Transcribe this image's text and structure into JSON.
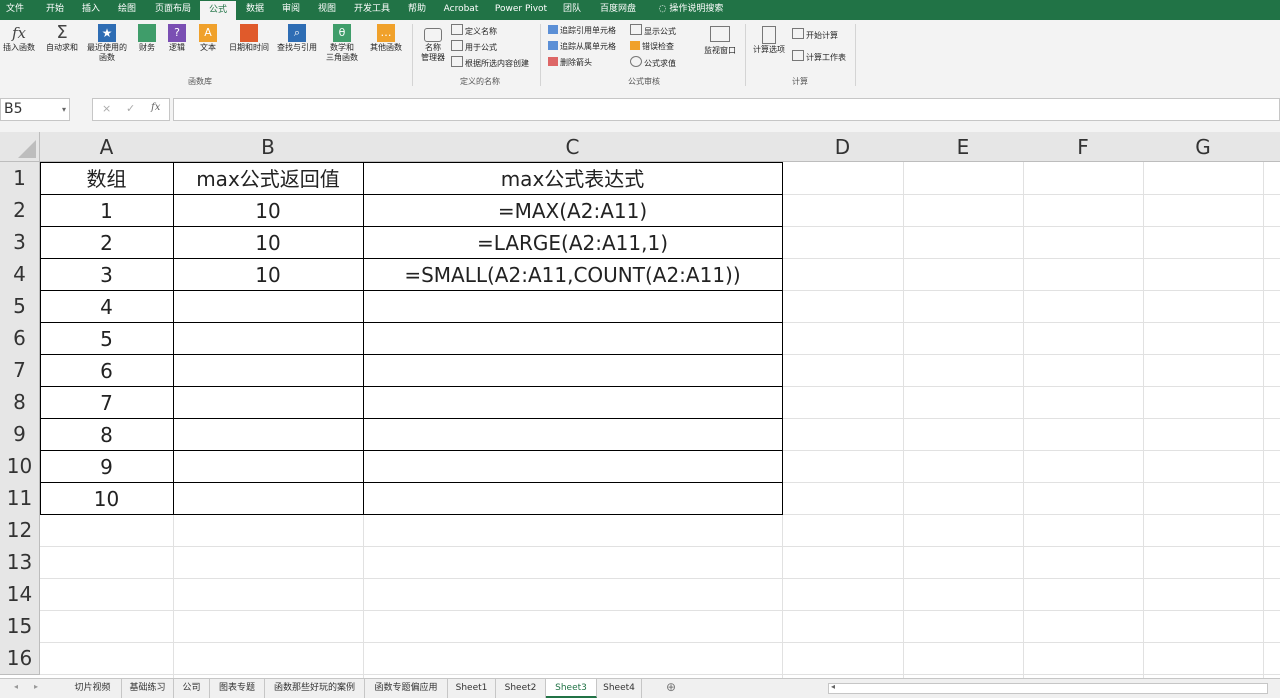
{
  "ribbon_tabs": [
    "文件",
    "开始",
    "插入",
    "绘图",
    "页面布局",
    "公式",
    "数据",
    "审阅",
    "视图",
    "开发工具",
    "帮助",
    "Acrobat",
    "Power Pivot",
    "团队",
    "百度网盘",
    "操作说明搜索"
  ],
  "ribbon": {
    "insert_function": "插入函数",
    "autosum": "自动求和",
    "recent": [
      "最近使用的",
      "函数"
    ],
    "financial": "财务",
    "logical": "逻辑",
    "text": "文本",
    "datetime": "日期和时间",
    "lookup": "查找与引用",
    "math": [
      "数学和",
      "三角函数"
    ],
    "other": "其他函数",
    "group_library": "函数库",
    "name_manager": [
      "名称",
      "管理器"
    ],
    "define_name": "定义名称",
    "use_in_formula": "用于公式",
    "create_from_selection": "根据所选内容创建",
    "group_names": "定义的名称",
    "trace_precedents": "追踪引用单元格",
    "trace_dependents": "追踪从属单元格",
    "remove_arrows": "删除箭头",
    "show_formulas": "显示公式",
    "error_checking": "错误检查",
    "evaluate_formula": "公式求值",
    "watch_window": "监视窗口",
    "group_audit": "公式审核",
    "calc_options": "计算选项",
    "calc_now": "开始计算",
    "calc_sheet": "计算工作表",
    "group_calc": "计算"
  },
  "formula_bar": {
    "name_box": "B5",
    "cancel_symbol": "×",
    "enter_symbol": "✓",
    "fx_symbol": "fx",
    "value": ""
  },
  "columns": [
    "A",
    "B",
    "C",
    "D",
    "E",
    "F",
    "G"
  ],
  "rows": [
    "1",
    "2",
    "3",
    "4",
    "5",
    "6",
    "7",
    "8",
    "9",
    "10",
    "11",
    "12",
    "13",
    "14",
    "15",
    "16"
  ],
  "table": {
    "headers": [
      "数组",
      "max公式返回值",
      "max公式表达式"
    ],
    "rows": [
      [
        "1",
        "10",
        "=MAX(A2:A11)"
      ],
      [
        "2",
        "10",
        "=LARGE(A2:A11,1)"
      ],
      [
        "3",
        "10",
        "=SMALL(A2:A11,COUNT(A2:A11))"
      ],
      [
        "4",
        "",
        ""
      ],
      [
        "5",
        "",
        ""
      ],
      [
        "6",
        "",
        ""
      ],
      [
        "7",
        "",
        ""
      ],
      [
        "8",
        "",
        ""
      ],
      [
        "9",
        "",
        ""
      ],
      [
        "10",
        "",
        ""
      ]
    ]
  },
  "sheet_tabs": [
    "切片视频",
    "基础练习",
    "公司",
    "图表专题",
    "函数那些好玩的案例",
    "函数专题偏应用",
    "Sheet1",
    "Sheet2",
    "Sheet3",
    "Sheet4"
  ],
  "active_sheet": "Sheet3",
  "add_sheet_symbol": "⊕",
  "colors": {
    "accent": "#217346",
    "grid": "#e1e1e1",
    "header_bg": "#e6e6e6"
  }
}
